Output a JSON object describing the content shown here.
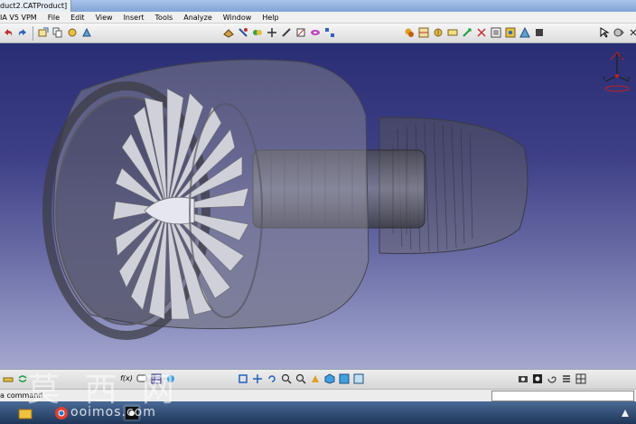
{
  "window": {
    "title": "duct2.CATProduct]"
  },
  "menu": {
    "items": [
      {
        "label": "IA V5 VPM"
      },
      {
        "label": "File"
      },
      {
        "label": "Edit"
      },
      {
        "label": "View"
      },
      {
        "label": "Insert"
      },
      {
        "label": "Tools"
      },
      {
        "label": "Analyze"
      },
      {
        "label": "Window"
      },
      {
        "label": "Help"
      }
    ]
  },
  "toolbar_top": {
    "standard_icons": [
      "undo-icon",
      "redo-icon",
      "component-icon",
      "copy-icon",
      "catalog-icon",
      "manipulation-icon"
    ],
    "assembly_icons": [
      "new-component-icon",
      "existing-component-icon",
      "snap-icon",
      "explode-icon",
      "constraint-icon",
      "fix-icon",
      "contact-icon",
      "offset-icon"
    ],
    "analysis_icons": [
      "clash-icon",
      "section-icon",
      "distance-icon",
      "band-icon",
      "measure-icon",
      "inertia-icon",
      "bom-icon",
      "scene-icon",
      "publish-icon",
      "stop-icon"
    ],
    "right_icons": [
      "select-icon",
      "tree-icon",
      "help-icon"
    ]
  },
  "compass": {
    "axis_labels": [
      "z",
      "y",
      "x"
    ]
  },
  "toolbar_bottom": {
    "formula_label": "f(x)",
    "view_icons": [
      "fly-icon",
      "fit-all-icon",
      "pan-icon",
      "rotate-icon",
      "zoom-in-icon",
      "zoom-out-icon",
      "normal-view-icon",
      "iso-view-icon",
      "render-style-icon",
      "hide-show-icon",
      "swap-icon"
    ]
  },
  "status": {
    "prompt": "a command",
    "command_placeholder": ""
  },
  "watermark": {
    "chars": "莫 西 网",
    "url": "ooimos.com"
  },
  "colors": {
    "viewport_top": "#2a2e74",
    "viewport_bottom": "#a4a8cf",
    "engine_grey": "#9a9aa4",
    "taskbar": "#1e3658"
  }
}
